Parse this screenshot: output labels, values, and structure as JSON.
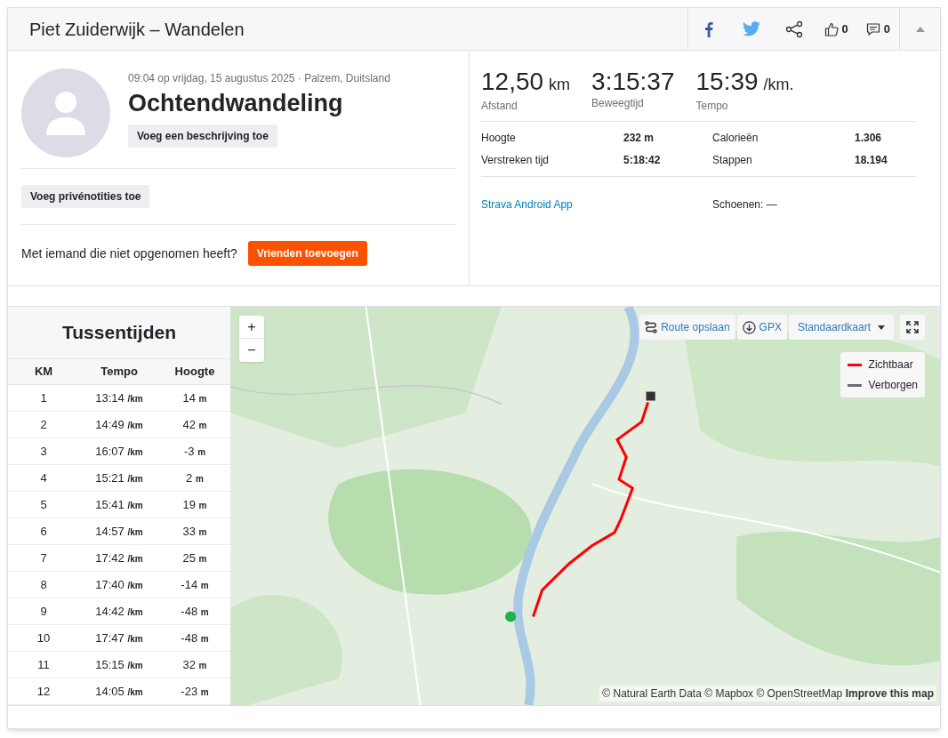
{
  "header": {
    "title": "Piet Zuiderwijk – Wandelen",
    "kudos": "0",
    "comments": "0"
  },
  "activity": {
    "meta": "09:04 op vrijdag, 15 augustus 2025 · Palzem, Duitsland",
    "title": "Ochtendwandeling",
    "add_description": "Voeg een beschrijving toe",
    "private_notes": "Voeg privénotities toe",
    "friends_prompt": "Met iemand die niet opgenomen heeft?",
    "friends_button": "Vrienden toevoegen"
  },
  "stats": {
    "primary": [
      {
        "value": "12,50",
        "unit": "km",
        "label": "Afstand"
      },
      {
        "value": "3:15:37",
        "label": "Beweegtijd"
      },
      {
        "value": "15:39",
        "unit": "/km.",
        "label": "Tempo"
      }
    ],
    "secondary": [
      {
        "label": "Hoogte",
        "value": "232 m"
      },
      {
        "label": "Calorieën",
        "value": "1.306"
      },
      {
        "label": "Verstreken tijd",
        "value": "5:18:42"
      },
      {
        "label": "Stappen",
        "value": "18.194"
      }
    ],
    "device": "Strava Android App",
    "shoes": "Schoenen: —"
  },
  "splits": {
    "title": "Tussentijden",
    "columns": [
      "KM",
      "Tempo",
      "Hoogte"
    ],
    "rows": [
      {
        "km": "1",
        "pace": "13:14",
        "pace_unit": "/km",
        "elevation": "14",
        "elevation_unit": "m"
      },
      {
        "km": "2",
        "pace": "14:49",
        "pace_unit": "/km",
        "elevation": "42",
        "elevation_unit": "m"
      },
      {
        "km": "3",
        "pace": "16:07",
        "pace_unit": "/km",
        "elevation": "-3",
        "elevation_unit": "m"
      },
      {
        "km": "4",
        "pace": "15:21",
        "pace_unit": "/km",
        "elevation": "2",
        "elevation_unit": "m"
      },
      {
        "km": "5",
        "pace": "15:41",
        "pace_unit": "/km",
        "elevation": "19",
        "elevation_unit": "m"
      },
      {
        "km": "6",
        "pace": "14:57",
        "pace_unit": "/km",
        "elevation": "33",
        "elevation_unit": "m"
      },
      {
        "km": "7",
        "pace": "17:42",
        "pace_unit": "/km",
        "elevation": "25",
        "elevation_unit": "m"
      },
      {
        "km": "8",
        "pace": "17:40",
        "pace_unit": "/km",
        "elevation": "-14",
        "elevation_unit": "m"
      },
      {
        "km": "9",
        "pace": "14:42",
        "pace_unit": "/km",
        "elevation": "-48",
        "elevation_unit": "m"
      },
      {
        "km": "10",
        "pace": "17:47",
        "pace_unit": "/km",
        "elevation": "-48",
        "elevation_unit": "m"
      },
      {
        "km": "11",
        "pace": "15:15",
        "pace_unit": "/km",
        "elevation": "32",
        "elevation_unit": "m"
      },
      {
        "km": "12",
        "pace": "14:05",
        "pace_unit": "/km",
        "elevation": "-23",
        "elevation_unit": "m"
      }
    ]
  },
  "map": {
    "zoom_in": "+",
    "zoom_out": "−",
    "save_route": "Route opslaan",
    "gpx": "GPX",
    "style": "Standaardkaart",
    "legend": [
      {
        "label": "Zichtbaar",
        "color": "#ff0000"
      },
      {
        "label": "Verborgen",
        "color": "#6d6d78"
      }
    ],
    "attribution": "© Natural Earth Data © Mapbox © OpenStreetMap",
    "improve": "Improve this map"
  }
}
